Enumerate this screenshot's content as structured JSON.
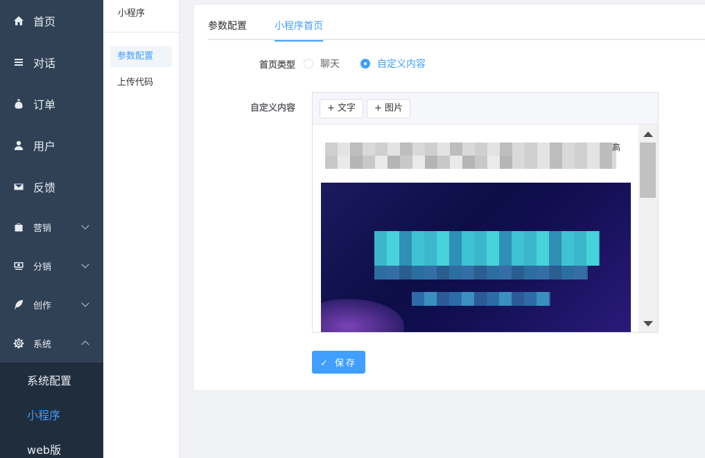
{
  "sidebar": {
    "items": [
      {
        "label": "首页",
        "icon": "home-icon"
      },
      {
        "label": "对话",
        "icon": "list-icon"
      },
      {
        "label": "订单",
        "icon": "bag-icon"
      },
      {
        "label": "用户",
        "icon": "user-icon"
      },
      {
        "label": "反馈",
        "icon": "mail-icon"
      },
      {
        "label": "营销",
        "icon": "shop-icon"
      },
      {
        "label": "分销",
        "icon": "money-icon"
      },
      {
        "label": "创作",
        "icon": "feather-icon"
      },
      {
        "label": "系统",
        "icon": "gear-icon"
      }
    ],
    "system_children": [
      "系统配置",
      "小程序",
      "web版"
    ]
  },
  "subcol": {
    "title": "小程序",
    "items": [
      "参数配置",
      "上传代码"
    ]
  },
  "tabs": [
    "参数配置",
    "小程序首页"
  ],
  "form": {
    "type_label": "首页类型",
    "type_options": [
      "聊天",
      "自定义内容"
    ],
    "selected_type": "自定义内容",
    "content_label": "自定义内容",
    "add_text": "+ 文字",
    "add_image": "+ 图片",
    "blurred_char": "高",
    "save_label": "保存"
  },
  "colors": {
    "sidebar_bg": "#304156",
    "submenu_bg": "#1f2d3d",
    "accent": "#409eff"
  }
}
